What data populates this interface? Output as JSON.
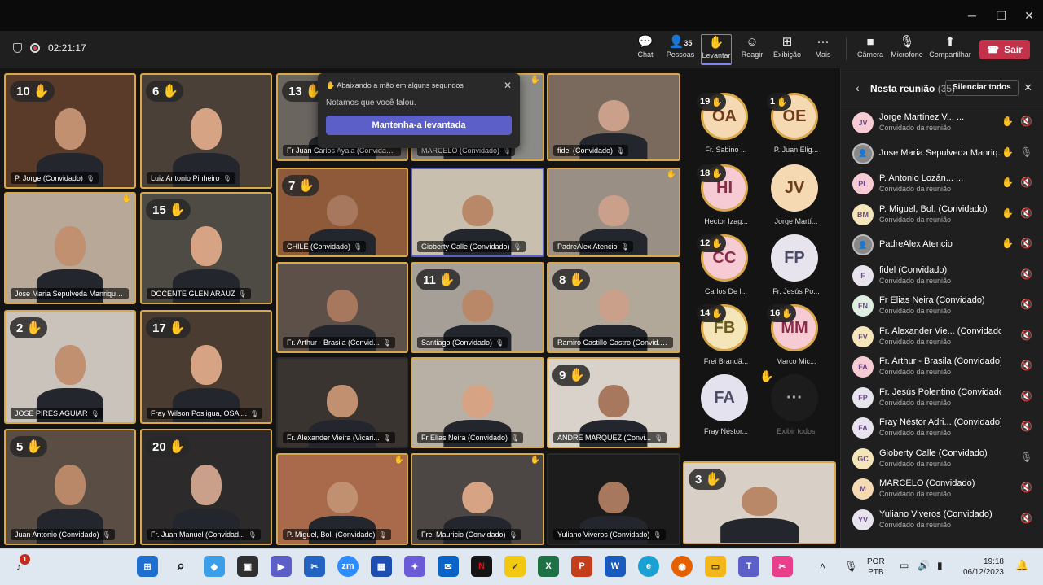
{
  "window": {
    "minimize": "─",
    "maximize": "❐",
    "close": "✕"
  },
  "toolbar": {
    "timer": "02:21:17",
    "chat": "Chat",
    "people": "Pessoas",
    "people_count": "35",
    "raise": "Levantar",
    "react": "Reagir",
    "view": "Exibição",
    "more": "Mais",
    "camera": "Câmera",
    "mic": "Microfone",
    "share": "Compartilhar",
    "leave": "Sair"
  },
  "popup": {
    "title": "Abaixando a mão em alguns segundos",
    "text": "Notamos que você falou.",
    "button": "Mantenha-a levantada"
  },
  "tiles": [
    {
      "name": "P. Jorge (Convidado)",
      "hand": "10"
    },
    {
      "name": "Luiz Antonio Pinheiro",
      "hand": "6"
    },
    {
      "name": "Fr Juan Carlos Ayala (Convidado)",
      "hand": "13"
    },
    {
      "name": "MARCELO (Convidado)",
      "hand": ""
    },
    {
      "name": "fidel (Convidado)",
      "hand": ""
    },
    {
      "name": "Jose Maria Sepulveda Manrique",
      "hand": ""
    },
    {
      "name": "DOCENTE GLEN ARAUZ",
      "hand": "15"
    },
    {
      "name": "CHILE (Convidado)",
      "hand": "7"
    },
    {
      "name": "Gioberty Calle (Convidado)",
      "hand": ""
    },
    {
      "name": "PadreAlex Atencio",
      "hand": ""
    },
    {
      "name": "JOSE PIRES AGUIAR",
      "hand": "2"
    },
    {
      "name": "Fray Wilson Posligua, OSA ...",
      "hand": "17"
    },
    {
      "name": "Fr. Arthur - Brasila (Convid...",
      "hand": ""
    },
    {
      "name": "Santiago (Convidado)",
      "hand": "11"
    },
    {
      "name": "Ramiro Castillo Castro (Convid...",
      "hand": "8"
    },
    {
      "name": "Fr. Alexander Vieira (Vicari...",
      "hand": ""
    },
    {
      "name": "Fr Elias Neira (Convidado)",
      "hand": ""
    },
    {
      "name": "ANDRE MARQUEZ (Convi...",
      "hand": "9"
    },
    {
      "name": "Juan Antonio (Convidado)",
      "hand": "5"
    },
    {
      "name": "Fr. Juan Manuel (Convidad...",
      "hand": "20"
    },
    {
      "name": "P. Miguel, Bol. (Convidado)",
      "hand": ""
    },
    {
      "name": "Frei Mauricio (Convidado)",
      "hand": ""
    },
    {
      "name": "Yuliano Viveros (Convidado)",
      "hand": ""
    },
    {
      "name": "",
      "hand": "3"
    }
  ],
  "avatars": [
    {
      "initials": "OA",
      "name": "Fr. Sabino ...",
      "hand": "19"
    },
    {
      "initials": "OE",
      "name": "P. Juan Elig...",
      "hand": "1"
    },
    {
      "initials": "HI",
      "name": "Hector Izag...",
      "hand": "18"
    },
    {
      "initials": "JV",
      "name": "Jorge Martí...",
      "hand": ""
    },
    {
      "initials": "CC",
      "name": "Carlos De l...",
      "hand": "12"
    },
    {
      "initials": "FP",
      "name": "Fr. Jesús Po...",
      "hand": ""
    },
    {
      "initials": "FB",
      "name": "Frei Brandã...",
      "hand": "14"
    },
    {
      "initials": "MM",
      "name": "Marco Mic...",
      "hand": "16"
    },
    {
      "initials": "FA",
      "name": "Fray Néstor...",
      "hand": ""
    },
    {
      "initials": "···",
      "name": "Exibir todos",
      "hand": ""
    }
  ],
  "panel": {
    "title": "Nesta reunião",
    "count": "(35)",
    "mute_all": "Silenciar todos",
    "guest_label": "Convidado da reunião",
    "people": [
      {
        "initials": "JV",
        "name": "Jorge Martínez V... ...",
        "sub": "Convidado da reunião",
        "hand": "✋"
      },
      {
        "initials": "",
        "name": "Jose Maria Sepulveda Manriq...",
        "sub": "",
        "hand": "✋"
      },
      {
        "initials": "PL",
        "name": "P. Antonio Lozán... ...",
        "sub": "Convidado da reunião",
        "hand": "✋"
      },
      {
        "initials": "BM",
        "name": "P. Miguel, Bol. (Convidado)",
        "sub": "Convidado da reunião",
        "hand": "✋"
      },
      {
        "initials": "",
        "name": "PadreAlex Atencio",
        "sub": "",
        "hand": "✋"
      },
      {
        "initials": "F",
        "name": "fidel (Convidado)",
        "sub": "Convidado da reunião",
        "hand": ""
      },
      {
        "initials": "FN",
        "name": "Fr Elias Neira (Convidado)",
        "sub": "Convidado da reunião",
        "hand": ""
      },
      {
        "initials": "FV",
        "name": "Fr. Alexander Vie... (Convidado)",
        "sub": "Convidado da reunião",
        "hand": ""
      },
      {
        "initials": "FA",
        "name": "Fr. Arthur - Brasila (Convidado)",
        "sub": "Convidado da reunião",
        "hand": ""
      },
      {
        "initials": "FP",
        "name": "Fr. Jesús Polentino (Convidado)",
        "sub": "Convidado da reunião",
        "hand": ""
      },
      {
        "initials": "FA",
        "name": "Fray Néstor Adri... (Convidado)",
        "sub": "Convidado da reunião",
        "hand": ""
      },
      {
        "initials": "GC",
        "name": "Gioberty Calle (Convidado)",
        "sub": "Convidado da reunião",
        "hand": ""
      },
      {
        "initials": "M",
        "name": "MARCELO (Convidado)",
        "sub": "Convidado da reunião",
        "hand": ""
      },
      {
        "initials": "YV",
        "name": "Yuliano Viveros (Convidado)",
        "sub": "Convidado da reunião",
        "hand": ""
      }
    ]
  },
  "taskbar": {
    "badge": "1",
    "lang1": "POR",
    "lang2": "PTB",
    "time": "19:18",
    "date": "06/12/2023"
  }
}
